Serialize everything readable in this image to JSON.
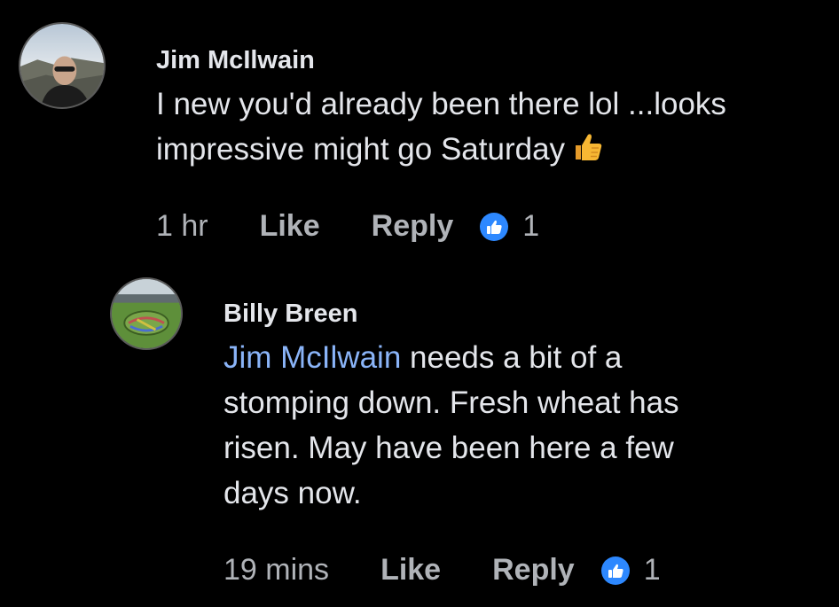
{
  "comments": [
    {
      "author": "Jim McIlwain",
      "text_line1": "I new you'd already been there lol ...looks",
      "text_line2": "impressive might go Saturday",
      "emoji": "thumbs-up-emoji",
      "time": "1 hr",
      "like_label": "Like",
      "reply_label": "Reply",
      "reaction_icon": "like-reaction-icon",
      "reaction_count": "1"
    },
    {
      "author": "Billy Breen",
      "mention": "Jim McIlwain",
      "text_line1_rest": " needs a bit of a",
      "text_line2": "stomping down. Fresh wheat has",
      "text_line3": "risen. May have been here a few",
      "text_line4": "days now.",
      "time": "19 mins",
      "like_label": "Like",
      "reply_label": "Reply",
      "reaction_icon": "like-reaction-icon",
      "reaction_count": "1"
    }
  ],
  "colors": {
    "background": "#000000",
    "text": "#e4e6eb",
    "meta": "#b0b3b8",
    "mention": "#8ab4f8",
    "reaction": "#2d88ff"
  }
}
